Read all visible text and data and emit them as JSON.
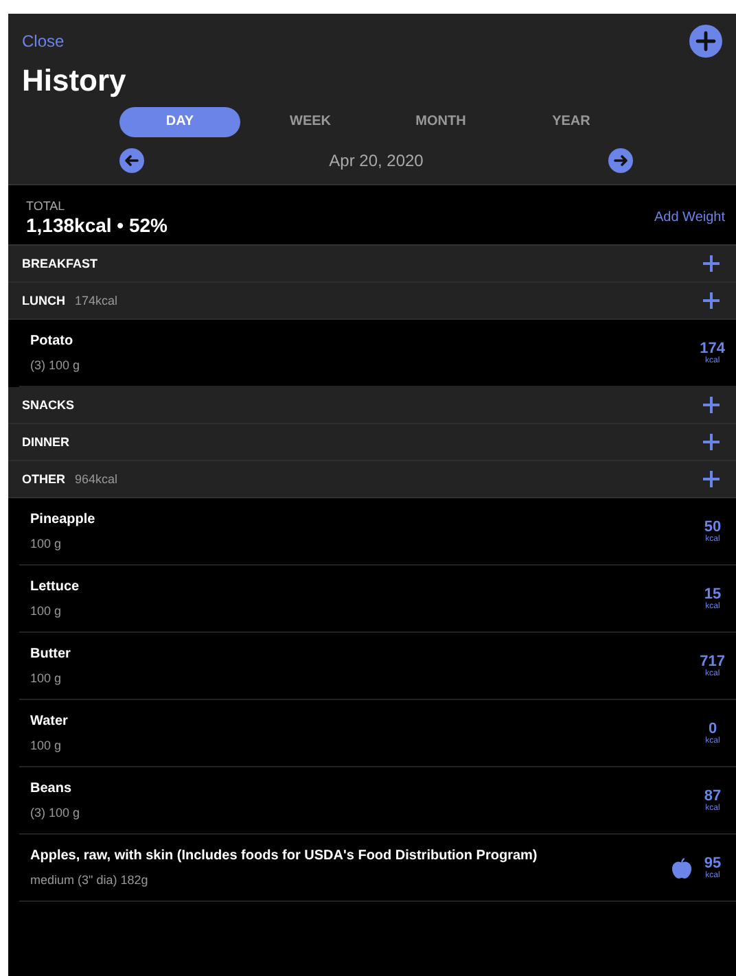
{
  "header": {
    "close": "Close",
    "title": "History"
  },
  "tabs": [
    {
      "label": "DAY",
      "selected": true
    },
    {
      "label": "WEEK",
      "selected": false
    },
    {
      "label": "MONTH",
      "selected": false
    },
    {
      "label": "YEAR",
      "selected": false
    }
  ],
  "date": "Apr 20, 2020",
  "total": {
    "label": "TOTAL",
    "value": "1,138kcal • 52%",
    "action": "Add Weight"
  },
  "meals": [
    {
      "name": "BREAKFAST"
    },
    {
      "name": "LUNCH",
      "total": "174kcal",
      "items": [
        {
          "name": "Potato",
          "amount": "(3) 100 g",
          "kcal": "174",
          "unit": "kcal",
          "apple_icon": false
        }
      ]
    },
    {
      "name": "SNACKS"
    },
    {
      "name": "DINNER"
    },
    {
      "name": "OTHER",
      "total": "964kcal",
      "items": [
        {
          "name": "Pineapple",
          "amount": "100 g",
          "kcal": "50",
          "unit": "kcal",
          "apple_icon": false
        },
        {
          "name": "Lettuce",
          "amount": "100 g",
          "kcal": "15",
          "unit": "kcal",
          "apple_icon": false
        },
        {
          "name": "Butter",
          "amount": "100 g",
          "kcal": "717",
          "unit": "kcal",
          "apple_icon": false
        },
        {
          "name": "Water",
          "amount": "100 g",
          "kcal": "0",
          "unit": "kcal",
          "apple_icon": false
        },
        {
          "name": "Beans",
          "amount": "(3) 100 g",
          "kcal": "87",
          "unit": "kcal",
          "apple_icon": false
        },
        {
          "name": "Apples, raw, with skin (Includes foods for USDA's Food Distribution Program)",
          "amount": "medium (3\" dia) 182g",
          "kcal": "95",
          "unit": "kcal",
          "apple_icon": true
        }
      ]
    }
  ]
}
